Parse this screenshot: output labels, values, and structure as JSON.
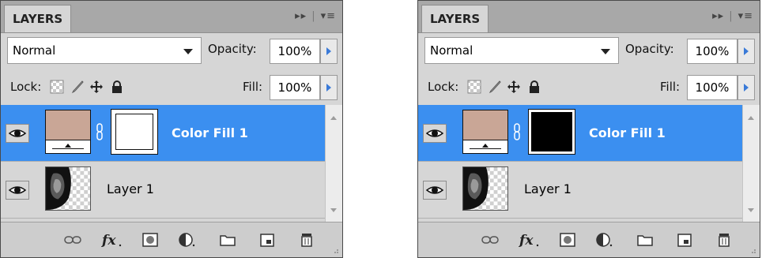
{
  "panels": [
    {
      "tab_label": "LAYERS",
      "blend_mode": "Normal",
      "opacity_label": "Opacity:",
      "opacity_value": "100%",
      "lock_label": "Lock:",
      "fill_label": "Fill:",
      "fill_value": "100%",
      "layers": [
        {
          "name": "Color Fill 1",
          "selected": true,
          "mask_color": "#ffffff"
        },
        {
          "name": "Layer 1",
          "selected": false
        }
      ]
    },
    {
      "tab_label": "LAYERS",
      "blend_mode": "Normal",
      "opacity_label": "Opacity:",
      "opacity_value": "100%",
      "lock_label": "Lock:",
      "fill_label": "Fill:",
      "fill_value": "100%",
      "layers": [
        {
          "name": "Color Fill 1",
          "selected": true,
          "mask_color": "#000000"
        },
        {
          "name": "Layer 1",
          "selected": false
        }
      ]
    }
  ],
  "colors": {
    "selection": "#3b8ff0",
    "fill_layer_color": "#c9a696",
    "panel_bg": "#d6d6d6"
  },
  "icons": [
    "expand-icon",
    "panel-menu-icon",
    "dropdown-caret-icon",
    "lock-transparent-icon",
    "lock-image-brush-icon",
    "lock-position-move-icon",
    "lock-all-padlock-icon",
    "eye-icon",
    "link-chain-icon",
    "fx-icon",
    "add-mask-icon",
    "adjustment-layer-icon",
    "new-group-folder-icon",
    "new-layer-icon",
    "trash-icon",
    "resize-grip-icon"
  ]
}
